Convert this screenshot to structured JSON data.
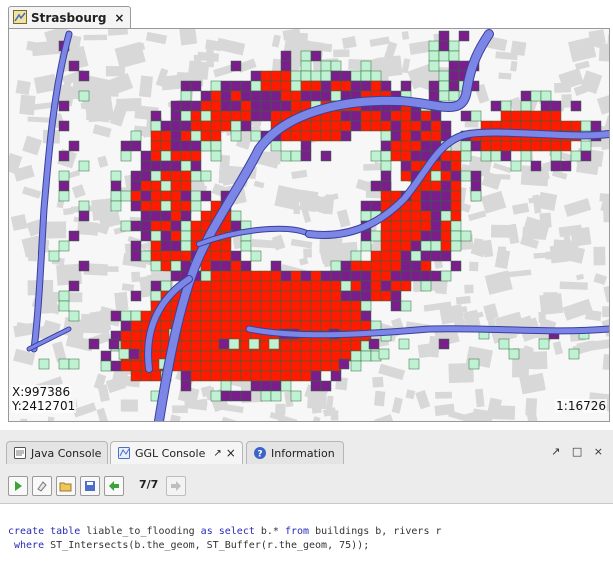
{
  "map_tab": {
    "title": "Strasbourg",
    "close": "×"
  },
  "map": {
    "coord_x": "X:997386",
    "coord_y": "Y:2412701",
    "scale": "1:16726",
    "colors": {
      "river": "#7b86e6",
      "river_outline": "#3a3f9a",
      "cell_high": "#ff1a00",
      "cell_medium": "#7a1e8c",
      "cell_low": "#bff2d2",
      "cell_border": "#2e6b3a",
      "buildings": "#d8d8d8",
      "background": "#f7f7f7"
    }
  },
  "console": {
    "tabs": [
      {
        "label": "Java Console",
        "icon": "java-console-icon",
        "active": false
      },
      {
        "label": "GGL Console",
        "icon": "ggl-console-icon",
        "active": true,
        "pin": "↗",
        "close": "×"
      },
      {
        "label": "Information",
        "icon": "information-icon",
        "active": false
      }
    ],
    "panel_controls": "↗ □ ×",
    "toolbar": {
      "history": "7/7",
      "buttons": [
        "run-icon",
        "clear-icon",
        "open-folder-icon",
        "save-icon",
        "previous-icon",
        "next-icon"
      ]
    },
    "editor": {
      "line1": {
        "kw1": "create table",
        "t1": " liable_to_flooding ",
        "kw2": "as select",
        "t2": " b.* ",
        "kw3": "from",
        "t3": " buildings b, rivers r"
      },
      "line2": {
        "kw1": "where",
        "t1": " ST_Intersects(b.the_geom, ST_Buffer(r.the_geom, 75));"
      }
    }
  }
}
